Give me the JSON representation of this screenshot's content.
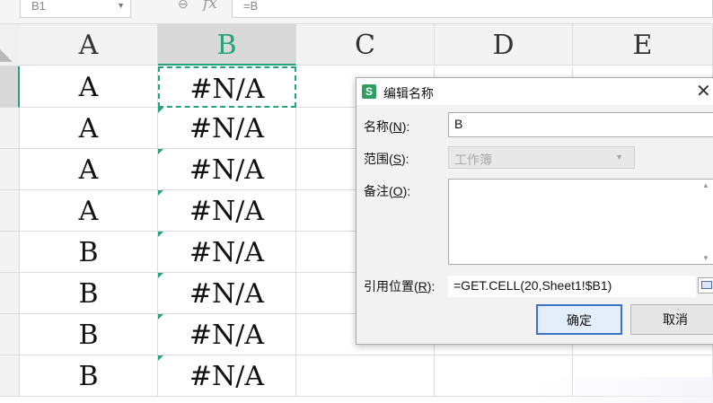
{
  "formula_bar": {
    "name_box": "B1",
    "fx_label": "fx",
    "formula": "=B"
  },
  "columns": [
    "A",
    "B",
    "C",
    "D",
    "E"
  ],
  "selected_column": "B",
  "rows": [
    {
      "a": "A",
      "b": "#N/A"
    },
    {
      "a": "A",
      "b": "#N/A"
    },
    {
      "a": "A",
      "b": "#N/A"
    },
    {
      "a": "A",
      "b": "#N/A"
    },
    {
      "a": "B",
      "b": "#N/A"
    },
    {
      "a": "B",
      "b": "#N/A"
    },
    {
      "a": "B",
      "b": "#N/A"
    },
    {
      "a": "B",
      "b": "#N/A"
    }
  ],
  "dialog": {
    "icon_letter": "S",
    "title": "编辑名称",
    "close_glyph": "✕",
    "name_label": "名称(",
    "name_key": "N",
    "name_label_end": "):",
    "name_value": "B",
    "scope_label": "范围(",
    "scope_key": "S",
    "scope_label_end": "):",
    "scope_value": "工作簿",
    "note_label": "备注(",
    "note_key": "O",
    "note_label_end": "):",
    "note_value": "",
    "ref_label": "引用位置(",
    "ref_key": "R",
    "ref_label_end": "):",
    "ref_value": "=GET.CELL(20,Sheet1!$B1)",
    "ok_label": "确定",
    "cancel_label": "取消"
  },
  "colors": {
    "accent": "#26a37a",
    "focus": "#3b73c6"
  }
}
